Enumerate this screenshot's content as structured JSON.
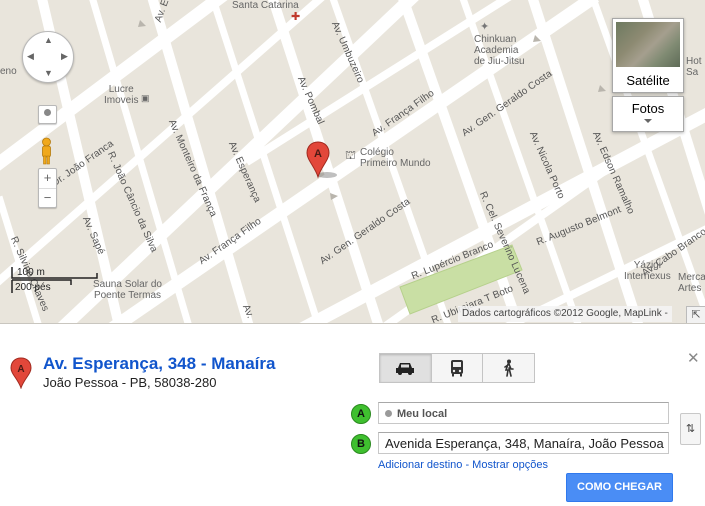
{
  "map": {
    "streets": [
      {
        "key": "av_esperanca_1",
        "text": "Av. Esperança"
      },
      {
        "key": "av_pombal",
        "text": "Av. Pombal"
      },
      {
        "key": "av_umbuzeiro",
        "text": "Av. Umbuzeiro"
      },
      {
        "key": "av_franca_filho_1",
        "text": "Av. França Filho"
      },
      {
        "key": "av_geraldo_costa_1",
        "text": "Av. Gen. Geraldo Costa"
      },
      {
        "key": "av_geraldo_costa_2",
        "text": "Av. Gen. Geraldo Costa"
      },
      {
        "key": "av_monteiro",
        "text": "Av. Monteiro da França"
      },
      {
        "key": "av_franca_filho_2",
        "text": "Av. França Filho"
      },
      {
        "key": "r_joao_cancio",
        "text": "R. João Câncio da Silva"
      },
      {
        "key": "dr_joao_franca",
        "text": "Dr. João Franca"
      },
      {
        "key": "av_sape",
        "text": "Av. Sapé"
      },
      {
        "key": "r_silvino",
        "text": "R. Silvino Chaves"
      },
      {
        "key": "av_nicola",
        "text": "Av. Nicola Porto"
      },
      {
        "key": "av_edson",
        "text": "Av. Edson Ramalho"
      },
      {
        "key": "r_augusto",
        "text": "R. Augusto Belmont"
      },
      {
        "key": "r_cel_severino",
        "text": "R. Cel. Severino Lucena"
      },
      {
        "key": "r_lupercio",
        "text": "R. Lupércio Branco"
      },
      {
        "key": "r_ubirajara",
        "text": "R. Ubirajara T Boto"
      },
      {
        "key": "av_cabo",
        "text": "Av. Cabo Branco"
      },
      {
        "key": "av_esperanca_top",
        "text": "Av. Esperança"
      },
      {
        "key": "r_top",
        "text": "Av."
      }
    ],
    "pois": {
      "santa_catarina": "Santa Catarina",
      "chinkuan": "Chinkuan\nAcademia\nde Jiu-Jitsu",
      "lucre": "Lucre\nImoveis",
      "colegio": "Colégio\nPrimeiro Mundo",
      "sauna": "Sauna Solar do\nPoente Termas",
      "yazigi": "Yázigi\nInternexus",
      "hot": "Hot\nSa",
      "merca": "Merca\nArtes",
      "eno": "eno"
    },
    "marker_letter": "A",
    "controls": {
      "satellite_label": "Satélite",
      "photos_label": "Fotos",
      "zoom_in": "+",
      "zoom_out": "−",
      "pan_up": "▲",
      "pan_down": "▼",
      "pan_left": "◀",
      "pan_right": "▶"
    },
    "scale": {
      "metric": "100 m",
      "imperial": "200 pés"
    },
    "attribution": "Dados cartográficos ©2012 Google, MapLink -",
    "corner_icon": "expand-corner-icon",
    "colors": {
      "road": "#ffffff",
      "block": "#e9e5dc",
      "park": "#c9dfa4",
      "marker": "#e2473a"
    }
  },
  "place": {
    "marker_letter": "A",
    "title": "Av. Esperança, 348 - Manaíra",
    "subtitle": "João Pessoa - PB, 58038-280"
  },
  "directions": {
    "modes": [
      {
        "key": "car",
        "icon": "car-icon",
        "active": true
      },
      {
        "key": "transit",
        "icon": "bus-icon",
        "active": false
      },
      {
        "key": "walk",
        "icon": "walk-icon",
        "active": false
      }
    ],
    "from_badge": "A",
    "from_value": "Meu local",
    "to_badge": "B",
    "to_value": "Avenida Esperança, 348, Manaíra, João Pessoa",
    "add_destination": "Adicionar destino",
    "separator": " - ",
    "show_options": "Mostrar opções",
    "submit_label": "COMO CHEGAR",
    "swap_icon": "⇅",
    "close_icon": "✕"
  }
}
